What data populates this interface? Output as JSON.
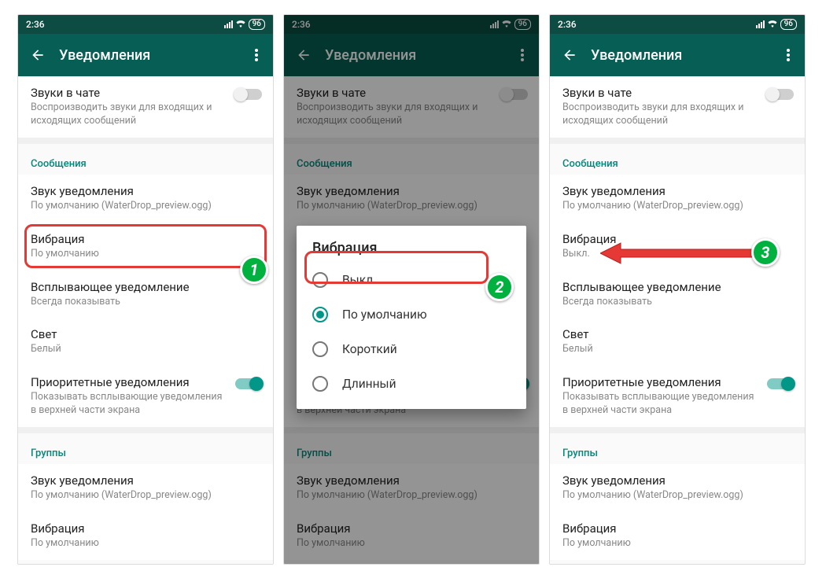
{
  "status": {
    "time": "2:36",
    "battery": "96"
  },
  "appbar": {
    "title": "Уведомления"
  },
  "chat_sounds": {
    "label": "Звуки в чате",
    "sub": "Воспроизводить звуки для входящих и исходящих сообщений"
  },
  "sections": {
    "messages": "Сообщения",
    "groups": "Группы"
  },
  "rows": {
    "notif_sound": {
      "label": "Звук уведомления",
      "sub": "По умолчанию (WaterDrop_preview.ogg)"
    },
    "vibration_default": {
      "label": "Вибрация",
      "sub": "По умолчанию"
    },
    "vibration_off": {
      "label": "Вибрация",
      "sub": "Выкл."
    },
    "popup": {
      "label": "Всплывающее уведомление",
      "sub": "Всегда показывать"
    },
    "light": {
      "label": "Свет",
      "sub": "Белый"
    },
    "priority": {
      "label": "Приоритетные уведомления",
      "sub": "Показывать всплывающие уведомления в верхней части экрана"
    }
  },
  "dialog": {
    "title": "Вибрация",
    "options": [
      "Выкл.",
      "По умолчанию",
      "Короткий",
      "Длинный"
    ]
  },
  "steps": {
    "s1": "1",
    "s2": "2",
    "s3": "3"
  }
}
